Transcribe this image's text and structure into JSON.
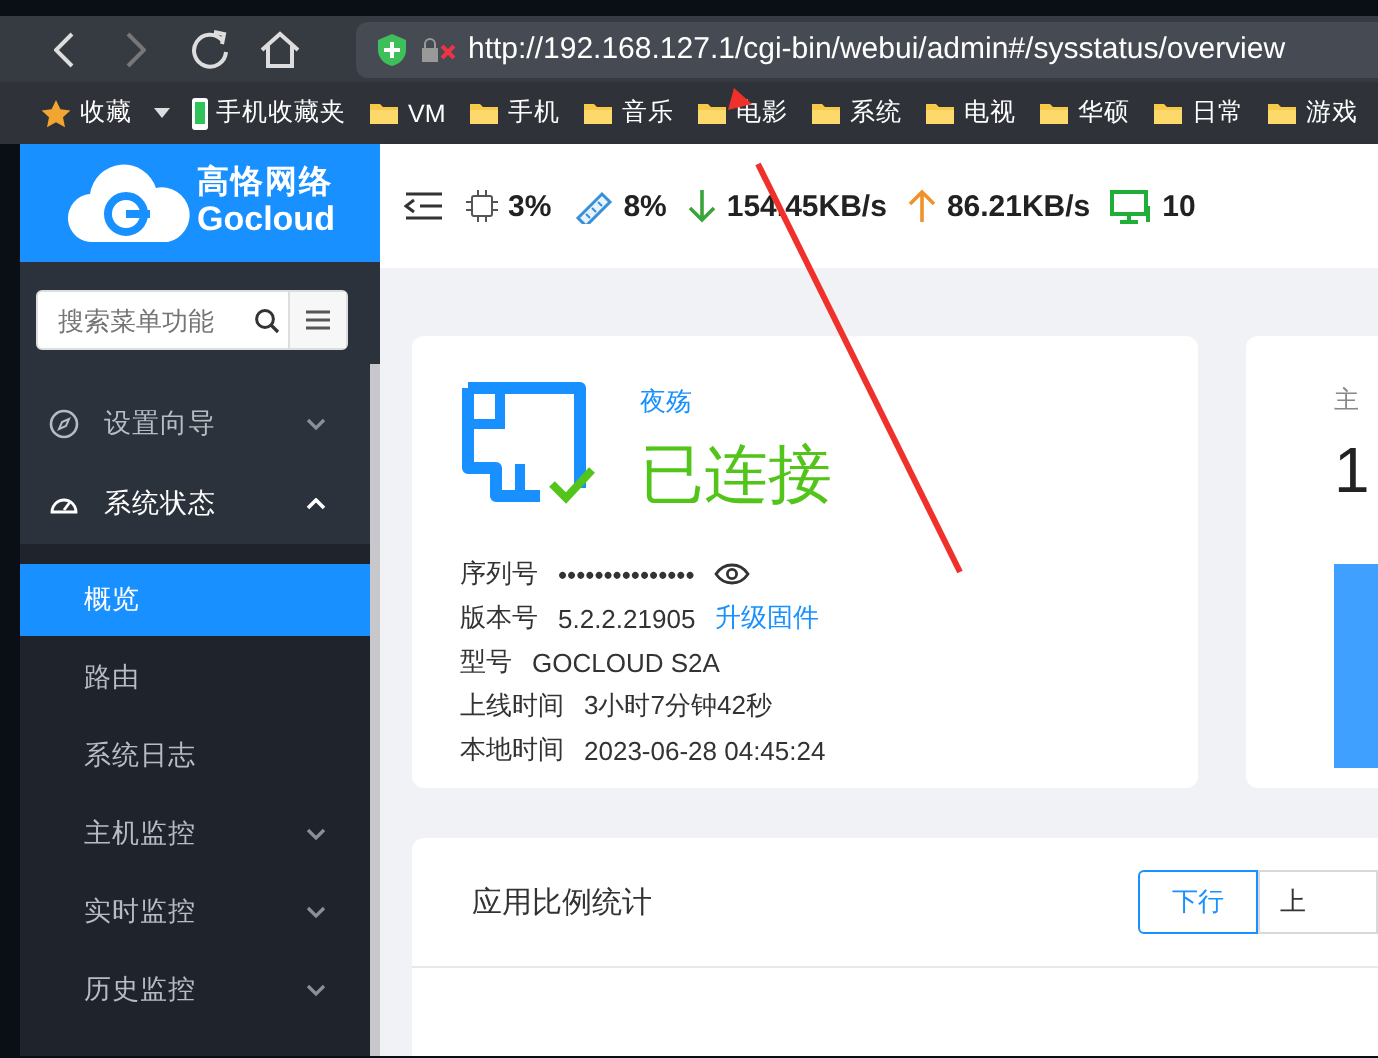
{
  "browser": {
    "url": "http://192.168.127.1/cgi-bin/webui/admin#/sysstatus/overview",
    "bookmarks": [
      {
        "kind": "star",
        "label": "收藏"
      },
      {
        "kind": "mobile",
        "label": "手机收藏夹"
      },
      {
        "kind": "folder",
        "label": "VM"
      },
      {
        "kind": "folder",
        "label": "手机"
      },
      {
        "kind": "folder",
        "label": "音乐"
      },
      {
        "kind": "folder",
        "label": "电影"
      },
      {
        "kind": "folder",
        "label": "系统"
      },
      {
        "kind": "folder",
        "label": "电视"
      },
      {
        "kind": "folder",
        "label": "华硕"
      },
      {
        "kind": "folder",
        "label": "日常"
      },
      {
        "kind": "folder",
        "label": "游戏"
      }
    ]
  },
  "logo": {
    "name": "高恪网络",
    "brand": "Gocloud"
  },
  "header_stats": [
    {
      "kind": "cpu",
      "value": "3%"
    },
    {
      "kind": "memory",
      "value": "8%"
    },
    {
      "kind": "download",
      "value": "154.45KB/s"
    },
    {
      "kind": "upload",
      "value": "86.21KB/s"
    },
    {
      "kind": "devices",
      "value": "10"
    }
  ],
  "sidebar": {
    "search": {
      "placeholder": "搜索菜单功能"
    },
    "items": [
      {
        "label": "设置向导",
        "expanded": false
      },
      {
        "label": "系统状态",
        "expanded": true,
        "children": [
          {
            "kind": "link",
            "label": "概览",
            "selected": true
          },
          {
            "kind": "link",
            "label": "路由",
            "selected": false
          },
          {
            "kind": "link",
            "label": "系统日志",
            "selected": false
          },
          {
            "kind": "group",
            "label": "主机监控",
            "selected": false,
            "expanded": false
          },
          {
            "kind": "group",
            "label": "实时监控",
            "selected": false,
            "expanded": false
          },
          {
            "kind": "group",
            "label": "历史监控",
            "selected": false,
            "expanded": false
          }
        ]
      }
    ]
  },
  "status_card": {
    "name": "夜殇",
    "status": "已连接",
    "info": [
      {
        "kind": "secret",
        "label": "序列号",
        "value": "•••••••••••••••"
      },
      {
        "kind": "version",
        "label": "版本号",
        "value": "5.2.2.21905",
        "link": "升级固件"
      },
      {
        "kind": "text",
        "label": "型号",
        "value": "GOCLOUD S2A"
      },
      {
        "kind": "text",
        "label": "上线时间",
        "value": "3小时7分钟42秒"
      },
      {
        "kind": "text",
        "label": "本地时间",
        "value": "2023-06-28 04:45:24"
      }
    ]
  },
  "host_card": {
    "label": "主",
    "value": "1"
  },
  "app_card": {
    "title": "应用比例统计",
    "buttons": [
      {
        "label": "下行",
        "selected": true
      },
      {
        "label": "上",
        "selected": false
      }
    ]
  }
}
